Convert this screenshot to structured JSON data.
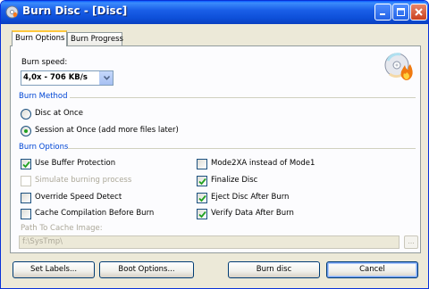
{
  "window": {
    "title": "Burn Disc - [Disc]",
    "app_icon": "burn-disc-app-icon",
    "controls": [
      "minimize-icon",
      "maximize-icon",
      "close-icon"
    ]
  },
  "tabs": [
    {
      "label": "Burn Options",
      "active": true
    },
    {
      "label": "Burn Progress",
      "active": false
    }
  ],
  "burn_speed": {
    "label": "Burn speed:",
    "selected": "4,0x - 706 KB/s",
    "icon": "cd-flame-icon"
  },
  "burn_method": {
    "title": "Burn Method",
    "options": [
      {
        "label": "Disc at Once",
        "selected": false
      },
      {
        "label": "Session at Once (add more files later)",
        "selected": true
      }
    ]
  },
  "burn_options": {
    "title": "Burn Options",
    "left": [
      {
        "label": "Use Buffer Protection",
        "checked": true,
        "enabled": true
      },
      {
        "label": "Simulate burning process",
        "checked": false,
        "enabled": false
      },
      {
        "label": "Override Speed Detect",
        "checked": false,
        "enabled": true
      },
      {
        "label": "Cache Compilation Before Burn",
        "checked": false,
        "enabled": true
      }
    ],
    "right": [
      {
        "label": "Mode2XA instead of Mode1",
        "checked": false,
        "enabled": true
      },
      {
        "label": "Finalize Disc",
        "checked": true,
        "enabled": true
      },
      {
        "label": "Eject Disc After Burn",
        "checked": true,
        "enabled": true
      },
      {
        "label": "Verify Data After Burn",
        "checked": true,
        "enabled": true
      }
    ]
  },
  "cache_path": {
    "label": "Path To Cache Image:",
    "value": "f:\\SysTmp\\",
    "browse_label": "...",
    "enabled": false
  },
  "buttons": {
    "set_labels": "Set Labels...",
    "boot_options": "Boot Options...",
    "burn_disc": "Burn disc",
    "cancel": "Cancel"
  },
  "colors": {
    "titlebar": "#0a5bff",
    "group_title": "#0046d5",
    "check_mark": "#21a121",
    "tab_highlight": "#ffc83c"
  }
}
